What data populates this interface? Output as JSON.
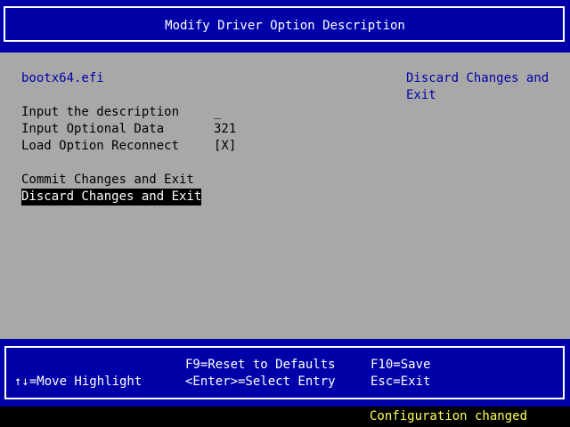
{
  "header": {
    "title": "Modify Driver Option Description"
  },
  "form": {
    "driver_name": "bootx64.efi",
    "fields": [
      {
        "label": "Input the description",
        "value": "_"
      },
      {
        "label": "Input Optional Data",
        "value": "321"
      },
      {
        "label": "Load Option Reconnect",
        "value": "[X]"
      }
    ],
    "actions": [
      {
        "label": "Commit Changes and Exit"
      },
      {
        "label": "Discard Changes and Exit"
      }
    ],
    "help_text_line1": "Discard Changes and",
    "help_text_line2": "Exit"
  },
  "footer": {
    "reset": "F9=Reset to Defaults",
    "save": "F10=Save",
    "move": "↑↓=Move Highlight",
    "select": "<Enter>=Select Entry",
    "exit": "Esc=Exit"
  },
  "status": {
    "message": "Configuration changed"
  },
  "colors": {
    "bios_blue": "#0000a8",
    "panel_gray": "#a8a8a8",
    "highlight_bg": "#000000",
    "status_yellow": "#ffff55"
  }
}
